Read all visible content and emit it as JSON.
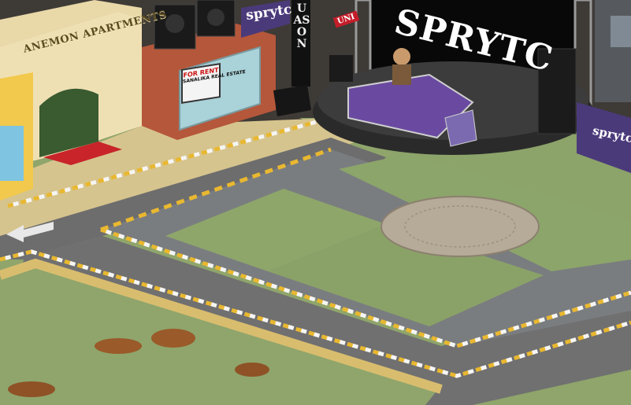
{
  "scene": {
    "type": "isometric virtual world street view",
    "buildings": {
      "apartment_sign": "ANEMON APARTMENTS",
      "rent_sign": {
        "line1": "FOR RENT",
        "line2": "SANALIKA REAL ESTATE"
      }
    },
    "banners": {
      "left_banner": "sprytc",
      "right_banner": "sprytc",
      "vertical_sign": "UASON",
      "red_sign": "UNI"
    },
    "stage": {
      "title": "SPRYTC"
    },
    "colors": {
      "grass": "#8ea46a",
      "road": "#6e6e6e",
      "curb_yellow": "#e8b630",
      "banner_purple": "#4a3a78",
      "stage_black": "#0a0a0a",
      "carpet_red": "#c8242a"
    }
  }
}
